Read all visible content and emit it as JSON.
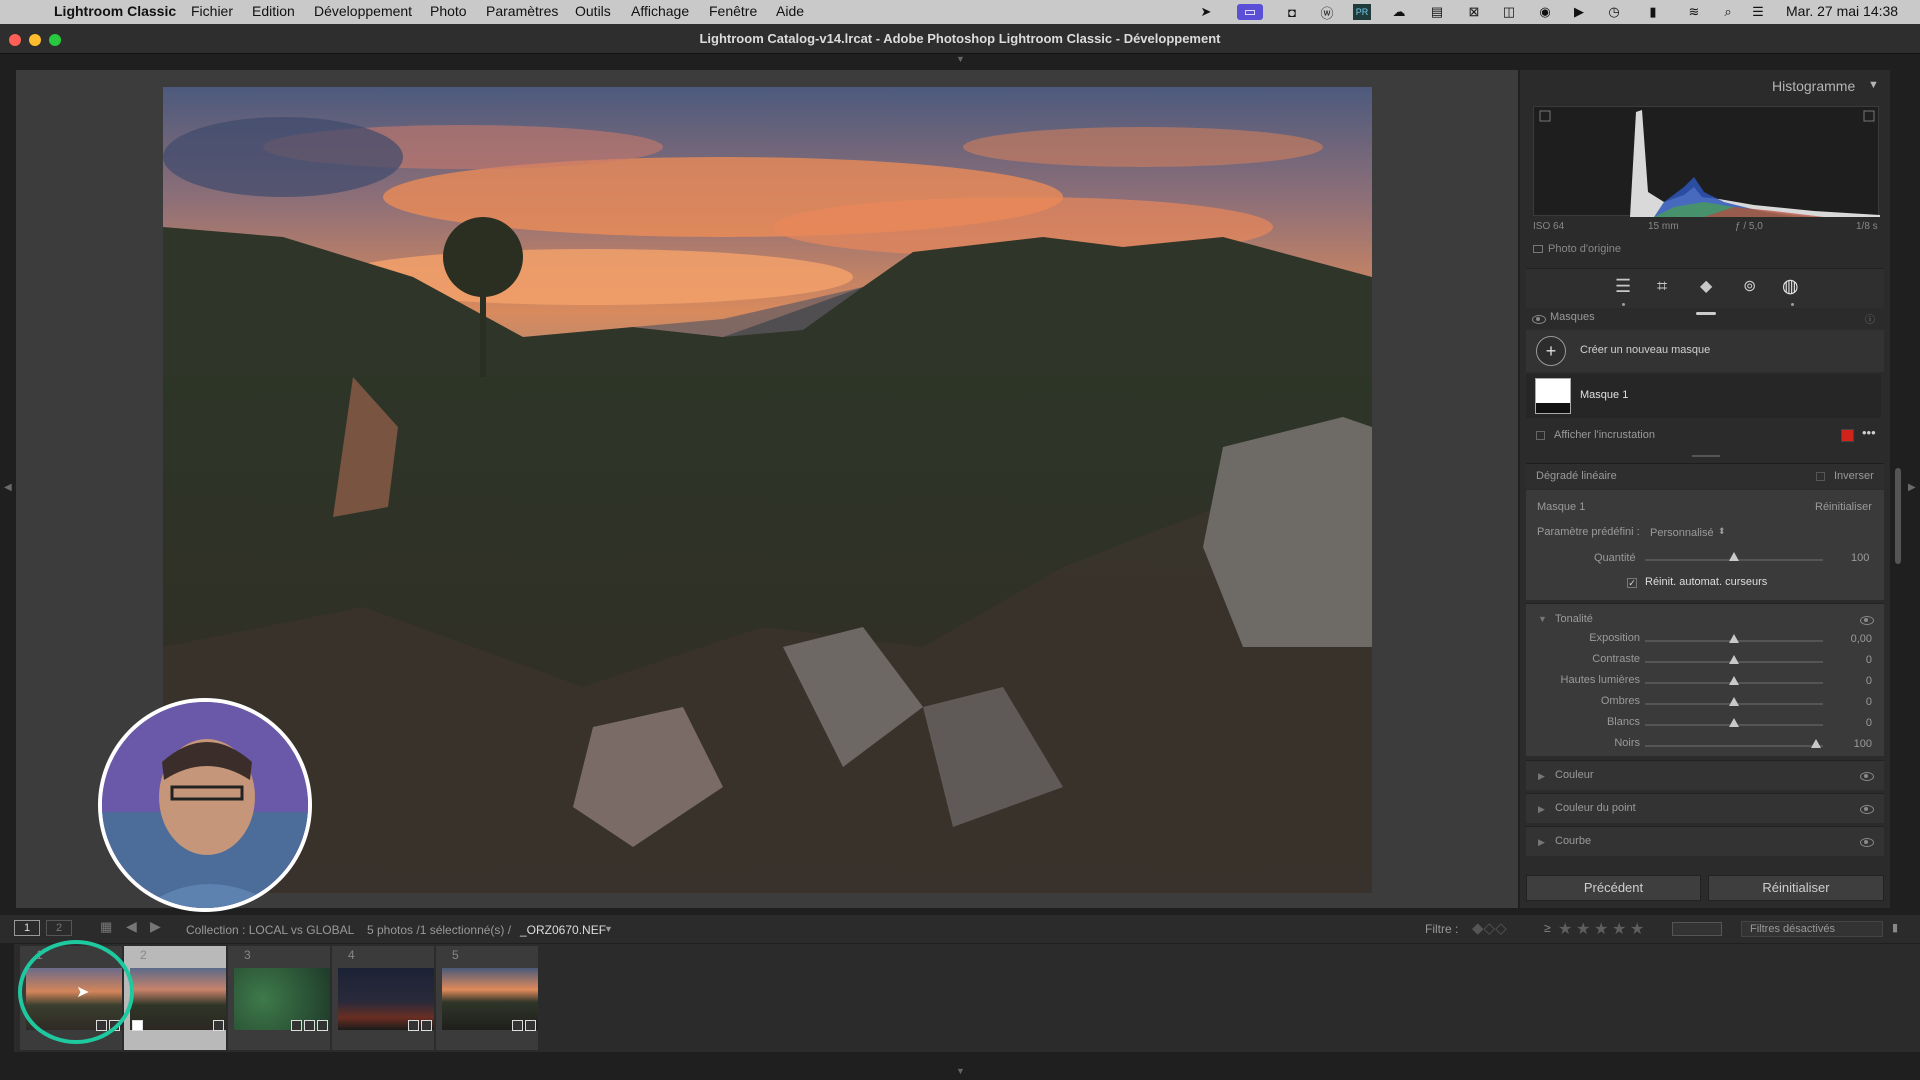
{
  "menubar": {
    "app": "Lightroom Classic",
    "items": [
      "Fichier",
      "Edition",
      "Développement",
      "Photo",
      "Paramètres",
      "Outils",
      "Affichage",
      "Fenêtre",
      "Aide"
    ],
    "clock": "Mar. 27 mai  14:38"
  },
  "window": {
    "title": "Lightroom Catalog-v14.lrcat - Adobe Photoshop Lightroom Classic - Développement"
  },
  "histogram": {
    "title": "Histogramme",
    "iso": "ISO 64",
    "focal": "15 mm",
    "aperture": "ƒ / 5,0",
    "shutter": "1/8 s",
    "original_photo": "Photo d'origine"
  },
  "masks": {
    "title": "Masques",
    "create_new": "Créer un nouveau masque",
    "mask1": "Masque 1",
    "show_overlay": "Afficher l'incrustation",
    "overlay_color": "#d0231a"
  },
  "gradient": {
    "title": "Dégradé linéaire",
    "invert": "Inverser",
    "mask_name": "Masque 1",
    "reset": "Réinitialiser",
    "preset_label": "Paramètre prédéfini :",
    "preset_value": "Personnalisé",
    "amount_label": "Quantité",
    "amount_value": "100",
    "auto_reset": "Réinit. automat. curseurs"
  },
  "tone": {
    "title": "Tonalité",
    "sliders": [
      {
        "label": "Exposition",
        "value": "0,00",
        "pos": 0.5
      },
      {
        "label": "Contraste",
        "value": "0",
        "pos": 0.5
      },
      {
        "label": "Hautes lumières",
        "value": "0",
        "pos": 0.5
      },
      {
        "label": "Ombres",
        "value": "0",
        "pos": 0.5
      },
      {
        "label": "Blancs",
        "value": "0",
        "pos": 0.5
      },
      {
        "label": "Noirs",
        "value": "100",
        "pos": 0.96
      }
    ]
  },
  "collapsed_sections": [
    "Couleur",
    "Couleur du point",
    "Courbe"
  ],
  "buttons": {
    "previous": "Précédent",
    "reset": "Réinitialiser"
  },
  "filmstrip_bar": {
    "page1": "1",
    "page2": "2",
    "collection": "Collection : LOCAL vs GLOBAL",
    "count": "5 photos /1 sélectionné(s) /",
    "filename": "_ORZ0670.NEF",
    "filter_label": "Filtre :",
    "filter_ge": "≥",
    "filters_off": "Filtres désactivés"
  },
  "thumbnails": [
    {
      "number": "1",
      "selected": true
    },
    {
      "number": "2",
      "selected": false
    },
    {
      "number": "3",
      "selected": false
    },
    {
      "number": "4",
      "selected": false
    },
    {
      "number": "5",
      "selected": false
    }
  ],
  "colors": {
    "accent_circle": "#1fc9a0",
    "panel": "#2b2b2b"
  }
}
